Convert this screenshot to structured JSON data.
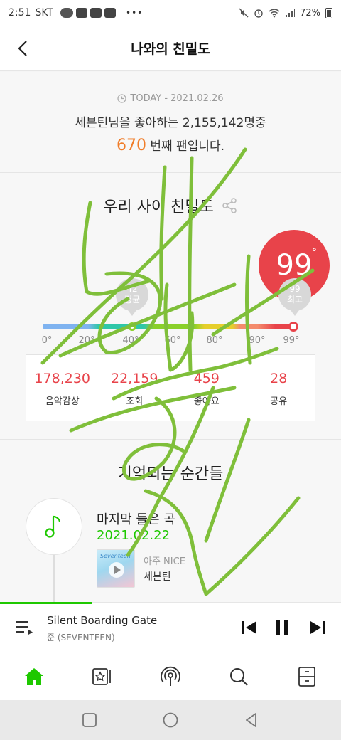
{
  "status_bar": {
    "time": "2:51",
    "carrier": "SKT",
    "battery": "72%",
    "dots": "•••"
  },
  "header": {
    "title": "나와의 친밀도"
  },
  "today": {
    "date": "TODAY - 2021.02.26",
    "line1": "세븐틴님을 좋아하는 2,155,142명중",
    "rank": "670",
    "line2_suffix": " 번째 팬입니다."
  },
  "affinity": {
    "title": "우리 사이 친밀도",
    "score": "99",
    "score_value": 99,
    "degree": "°",
    "avg_value": "42",
    "avg_label": "평균",
    "max_value": "99",
    "max_label": "최고",
    "scale_labels": [
      "0°",
      "20°",
      "40°",
      "60°",
      "80°",
      "90°",
      "99°"
    ],
    "stats": [
      {
        "value": "178,230",
        "label": "음악감상"
      },
      {
        "value": "22,159",
        "label": "조회"
      },
      {
        "value": "459",
        "label": "좋아요"
      },
      {
        "value": "28",
        "label": "공유"
      }
    ]
  },
  "memories": {
    "title": "기억되는 순간들",
    "item_label": "마지막 들은 곡",
    "item_date": "2021.02.22",
    "album_art_text": "Seventeen",
    "album": "아주 NICE",
    "artist": "세븐틴"
  },
  "player": {
    "title": "Silent Boarding Gate",
    "artist": "준 (SEVENTEEN)",
    "progress_fraction": 0.27
  },
  "colors": {
    "accent_green": "#1ec800",
    "score_red": "#e8434a",
    "rank_orange": "#f07c28",
    "scribble_green": "#7fbf3a"
  },
  "icons": {
    "nav": [
      "home-icon",
      "playlist-star-icon",
      "podcast-icon",
      "search-icon",
      "library-icon"
    ]
  }
}
